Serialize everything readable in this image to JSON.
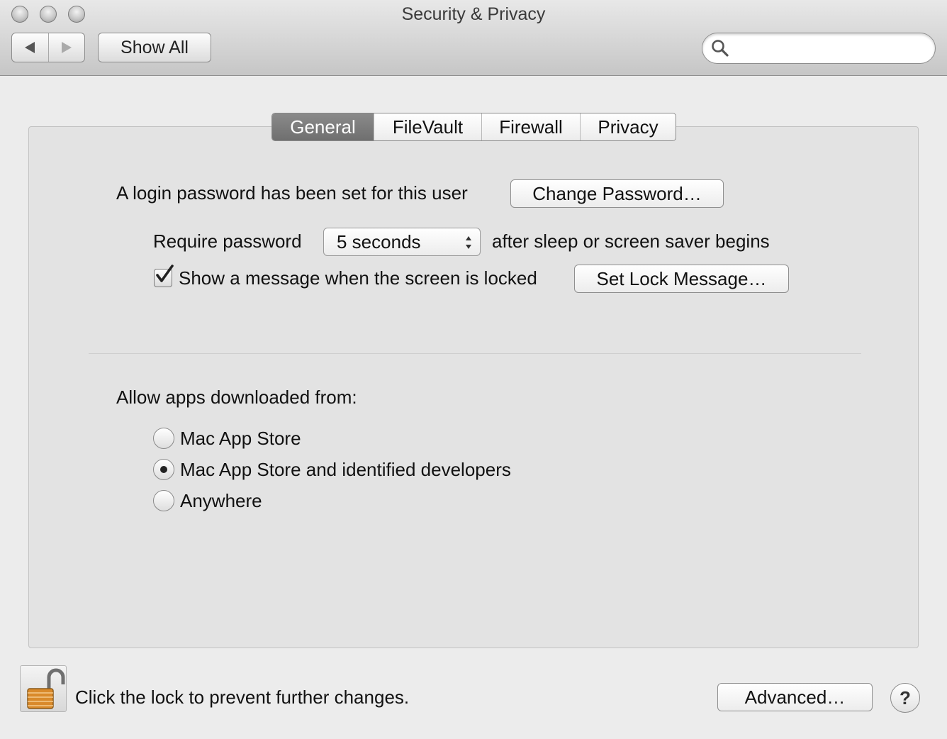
{
  "window": {
    "title": "Security & Privacy"
  },
  "toolbar": {
    "show_all_label": "Show All",
    "search_placeholder": ""
  },
  "tabs": [
    {
      "label": "General",
      "active": true
    },
    {
      "label": "FileVault",
      "active": false
    },
    {
      "label": "Firewall",
      "active": false
    },
    {
      "label": "Privacy",
      "active": false
    }
  ],
  "general": {
    "login_text": "A login password has been set for this user",
    "change_password_label": "Change Password…",
    "require_password_label": "Require password",
    "require_password_value": "5 seconds",
    "after_sleep_text": "after sleep or screen saver begins",
    "show_message_label": "Show a message when the screen is locked",
    "show_message_checked": true,
    "set_lock_message_label": "Set Lock Message…",
    "allow_apps_label": "Allow apps downloaded from:",
    "allow_options": [
      {
        "label": "Mac App Store",
        "selected": false
      },
      {
        "label": "Mac App Store and identified developers",
        "selected": true
      },
      {
        "label": "Anywhere",
        "selected": false
      }
    ]
  },
  "footer": {
    "lock_text": "Click the lock to prevent further changes.",
    "advanced_label": "Advanced…",
    "help_label": "?"
  },
  "icons": [
    "close-icon",
    "minimize-icon",
    "zoom-icon",
    "back-icon",
    "forward-icon",
    "search-icon",
    "lock-icon",
    "checkmark-icon",
    "popup-arrows-icon",
    "help-icon"
  ]
}
